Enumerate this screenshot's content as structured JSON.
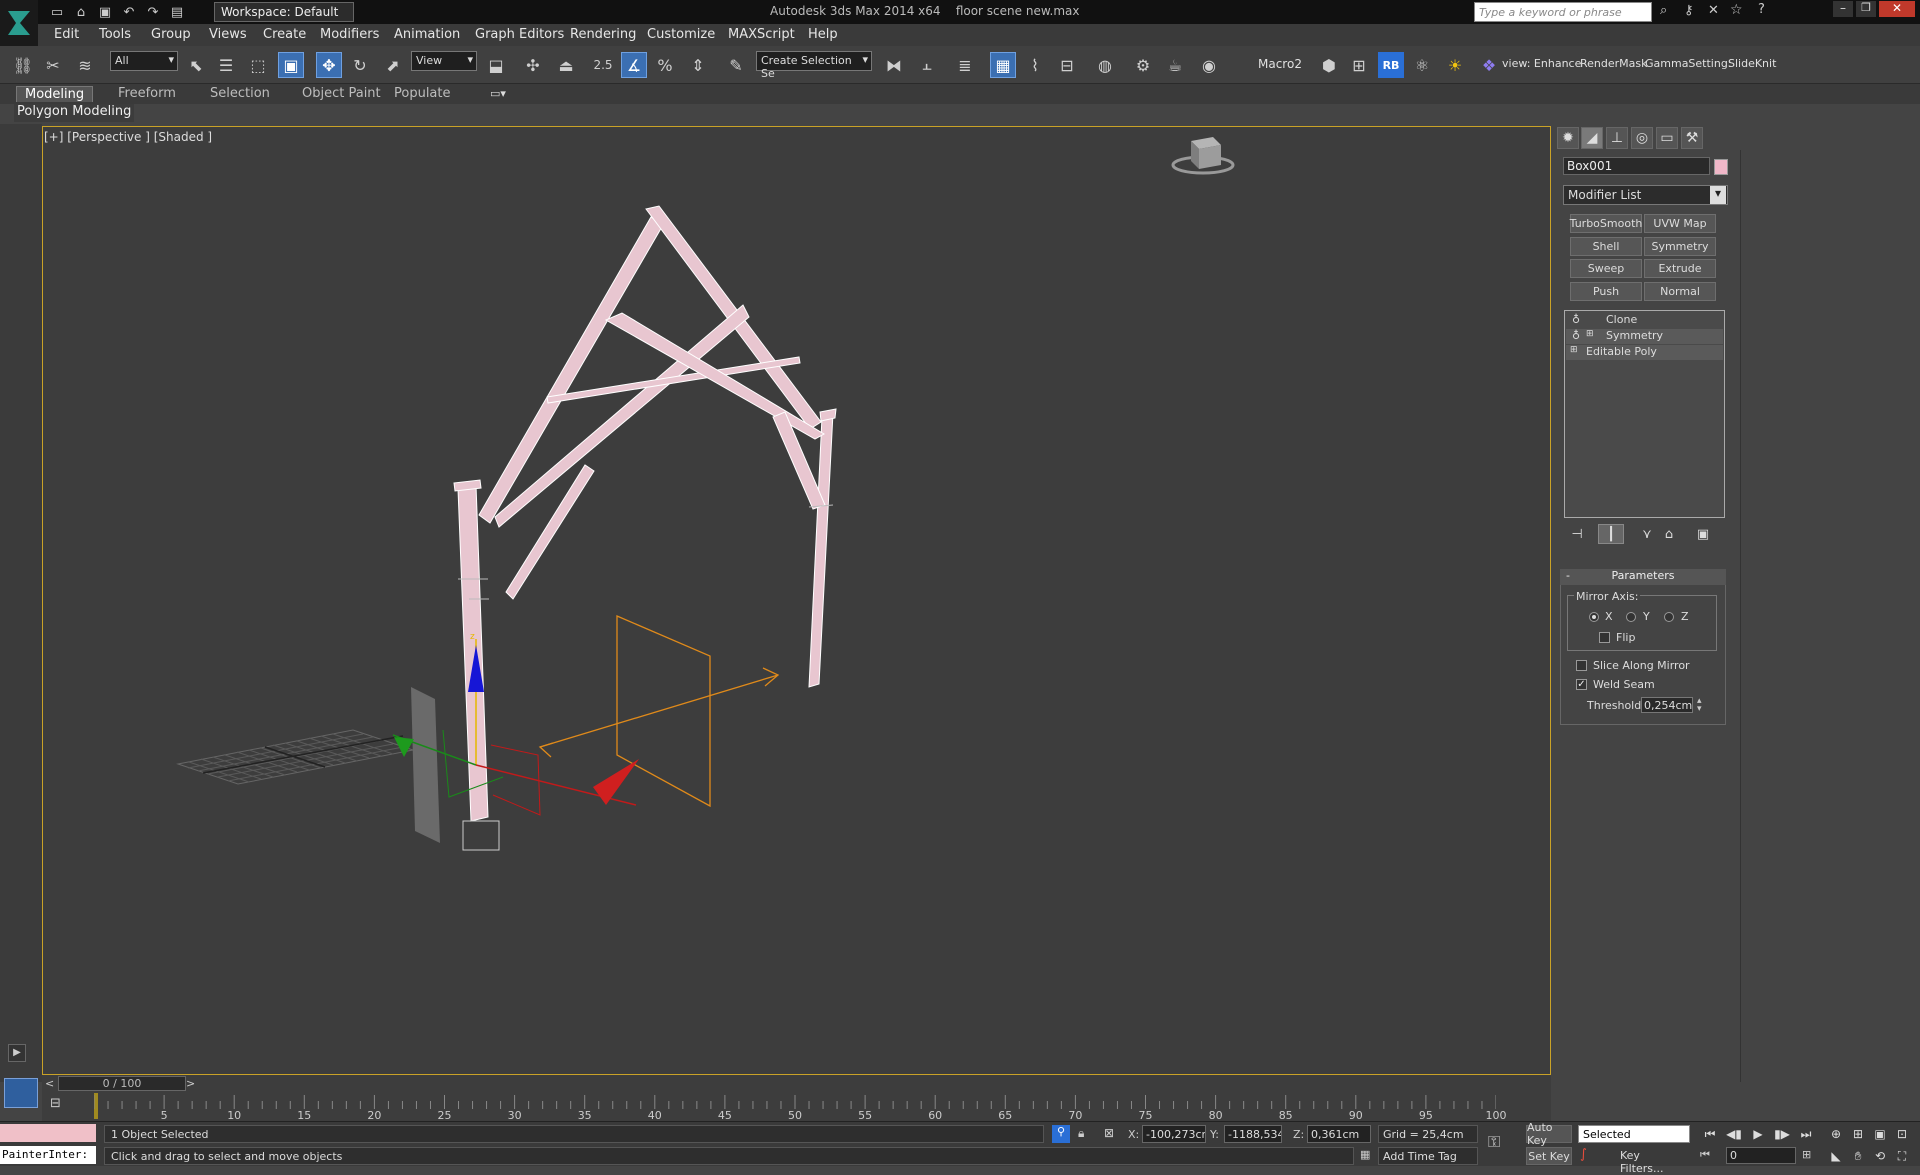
{
  "titlebar": {
    "workspace": "Workspace: Default",
    "app_title": "Autodesk 3ds Max  2014 x64",
    "file_title": "floor scene new.max",
    "search_placeholder": "Type a keyword or phrase"
  },
  "menu": [
    "Edit",
    "Tools",
    "Group",
    "Views",
    "Create",
    "Modifiers",
    "Animation",
    "Graph Editors",
    "Rendering",
    "Customize",
    "MAXScript",
    "Help"
  ],
  "toolbar": {
    "selection_filter": "All",
    "ref_coord": "View",
    "snap_value": "2.5",
    "named_selection": "Create Selection Se",
    "macro_label": "Macro2",
    "rb_label": "RB",
    "view_enhance": "view: Enhance",
    "render_mask": "RenderMask",
    "gamma_settings": "GammaSetting:",
    "slide_knit": "SlideKnit"
  },
  "ribbon": {
    "tabs": [
      "Modeling",
      "Freeform",
      "Selection",
      "Object Paint",
      "Populate"
    ],
    "panel": "Polygon Modeling"
  },
  "viewport": {
    "label": "[+] [Perspective ] [Shaded ]",
    "gizmo_z": "z"
  },
  "command_panel": {
    "object_name": "Box001",
    "object_color": "#f0b7c8",
    "modifier_list": "Modifier List",
    "modifier_buttons": [
      "TurboSmooth",
      "UVW Map",
      "Shell",
      "Symmetry",
      "Sweep",
      "Extrude",
      "Push",
      "Normal"
    ],
    "stack": [
      "Clone",
      "Symmetry",
      "Editable Poly"
    ],
    "rollout_title": "Parameters",
    "mirror_axis": "Mirror Axis:",
    "axis_x": "X",
    "axis_y": "Y",
    "axis_z": "Z",
    "flip": "Flip",
    "slice_along_mirror": "Slice Along Mirror",
    "weld_seam": "Weld Seam",
    "threshold_label": "Threshold:",
    "threshold_value": "0,254cm"
  },
  "timeline": {
    "frame": "0 / 100",
    "ticks": [
      "0",
      "5",
      "10",
      "15",
      "20",
      "25",
      "30",
      "35",
      "40",
      "45",
      "50",
      "55",
      "60",
      "65",
      "70",
      "75",
      "80",
      "85",
      "90",
      "95",
      "100"
    ]
  },
  "status": {
    "selection": "1 Object Selected",
    "prompt": "Click and drag to select and move objects",
    "painter": "PainterInter:",
    "x_label": "X:",
    "x_value": "-100,273cm",
    "y_label": "Y:",
    "y_value": "-1188,534",
    "z_label": "Z:",
    "z_value": "0,361cm",
    "grid": "Grid = 25,4cm",
    "add_time_tag": "Add Time Tag",
    "auto_key": "Auto Key",
    "set_key": "Set Key",
    "selected": "Selected",
    "key_filters": "Key Filters...",
    "current_frame": "0"
  }
}
